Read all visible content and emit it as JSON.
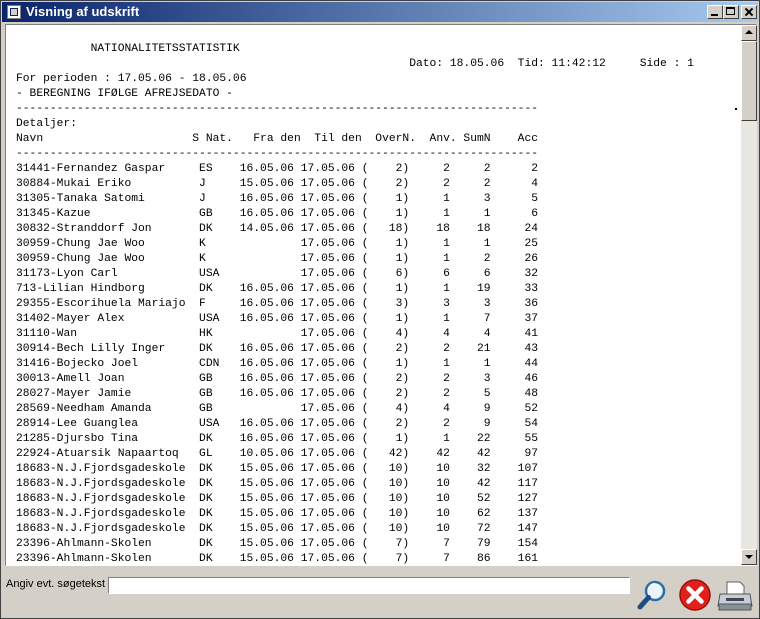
{
  "window": {
    "title": "Visning af udskrift"
  },
  "report": {
    "title": "NATIONALITETSSTATISTIK",
    "date_label": "Dato:",
    "date": "18.05.06",
    "time_label": "Tid:",
    "time": "11:42:12",
    "page_label": "Side :",
    "page": "1",
    "period_label": "For perioden :",
    "period": "17.05.06 - 18.05.06",
    "subtitle": "- BEREGNING IFØLGE AFREJSEDATO -",
    "section_label": "Detaljer:",
    "columns": [
      "Navn",
      "S",
      "Nat.",
      "Fra den",
      "Til den",
      "OverN.",
      "Anv.",
      "SumN",
      "Acc"
    ],
    "rows": [
      [
        "31441-Fernandez Gaspar",
        "",
        "ES",
        "16.05.06",
        "17.05.06",
        "2",
        "2",
        "2",
        "2"
      ],
      [
        "30884-Mukai Eriko",
        "",
        "J",
        "15.05.06",
        "17.05.06",
        "2",
        "2",
        "2",
        "4"
      ],
      [
        "31305-Tanaka Satomi",
        "",
        "J",
        "16.05.06",
        "17.05.06",
        "1",
        "1",
        "3",
        "5"
      ],
      [
        "31345-Kazue",
        "",
        "GB",
        "16.05.06",
        "17.05.06",
        "1",
        "1",
        "1",
        "6"
      ],
      [
        "30832-Stranddorf Jon",
        "",
        "DK",
        "14.05.06",
        "17.05.06",
        "18",
        "18",
        "18",
        "24"
      ],
      [
        "30959-Chung Jae Woo",
        "",
        "K",
        "",
        "17.05.06",
        "1",
        "1",
        "1",
        "25"
      ],
      [
        "30959-Chung Jae Woo",
        "",
        "K",
        "",
        "17.05.06",
        "1",
        "1",
        "2",
        "26"
      ],
      [
        "31173-Lyon Carl",
        "",
        "USA",
        "",
        "17.05.06",
        "6",
        "6",
        "6",
        "32"
      ],
      [
        "713-Lilian Hindborg",
        "",
        "DK",
        "16.05.06",
        "17.05.06",
        "1",
        "1",
        "19",
        "33"
      ],
      [
        "29355-Escorihuela Mariajo",
        "",
        "F",
        "16.05.06",
        "17.05.06",
        "3",
        "3",
        "3",
        "36"
      ],
      [
        "31402-Mayer Alex",
        "",
        "USA",
        "16.05.06",
        "17.05.06",
        "1",
        "1",
        "7",
        "37"
      ],
      [
        "31110-Wan",
        "",
        "HK",
        "",
        "17.05.06",
        "4",
        "4",
        "4",
        "41"
      ],
      [
        "30914-Bech Lilly Inger",
        "",
        "DK",
        "16.05.06",
        "17.05.06",
        "2",
        "2",
        "21",
        "43"
      ],
      [
        "31416-Bojecko Joel",
        "",
        "CDN",
        "16.05.06",
        "17.05.06",
        "1",
        "1",
        "1",
        "44"
      ],
      [
        "30013-Amell Joan",
        "",
        "GB",
        "16.05.06",
        "17.05.06",
        "2",
        "2",
        "3",
        "46"
      ],
      [
        "28027-Mayer Jamie",
        "",
        "GB",
        "16.05.06",
        "17.05.06",
        "2",
        "2",
        "5",
        "48"
      ],
      [
        "28569-Needham Amanda",
        "",
        "GB",
        "",
        "17.05.06",
        "4",
        "4",
        "9",
        "52"
      ],
      [
        "28914-Lee Guanglea",
        "",
        "USA",
        "16.05.06",
        "17.05.06",
        "2",
        "2",
        "9",
        "54"
      ],
      [
        "21285-Djursbo Tina",
        "",
        "DK",
        "16.05.06",
        "17.05.06",
        "1",
        "1",
        "22",
        "55"
      ],
      [
        "22924-Atuarsik Napaartoq",
        "",
        "GL",
        "10.05.06",
        "17.05.06",
        "42",
        "42",
        "42",
        "97"
      ],
      [
        "18683-N.J.Fjordsgadeskole",
        "",
        "DK",
        "15.05.06",
        "17.05.06",
        "10",
        "10",
        "32",
        "107"
      ],
      [
        "18683-N.J.Fjordsgadeskole",
        "",
        "DK",
        "15.05.06",
        "17.05.06",
        "10",
        "10",
        "42",
        "117"
      ],
      [
        "18683-N.J.Fjordsgadeskole",
        "",
        "DK",
        "15.05.06",
        "17.05.06",
        "10",
        "10",
        "52",
        "127"
      ],
      [
        "18683-N.J.Fjordsgadeskole",
        "",
        "DK",
        "15.05.06",
        "17.05.06",
        "10",
        "10",
        "62",
        "137"
      ],
      [
        "18683-N.J.Fjordsgadeskole",
        "",
        "DK",
        "15.05.06",
        "17.05.06",
        "10",
        "10",
        "72",
        "147"
      ],
      [
        "23396-Ahlmann-Skolen",
        "",
        "DK",
        "15.05.06",
        "17.05.06",
        "7",
        "7",
        "79",
        "154"
      ],
      [
        "23396-Ahlmann-Skolen",
        "",
        "DK",
        "15.05.06",
        "17.05.06",
        "7",
        "7",
        "86",
        "161"
      ]
    ]
  },
  "search": {
    "label": "Angiv evt. søgetekst",
    "value": "",
    "placeholder": ""
  },
  "icons": {
    "search": "magnifier-icon",
    "close": "red-x-icon",
    "print": "printer-icon"
  },
  "colors": {
    "titlebar_start": "#0a246a",
    "titlebar_end": "#a6caf0",
    "close_red": "#e0201b",
    "window_face": "#d4d0c8"
  }
}
